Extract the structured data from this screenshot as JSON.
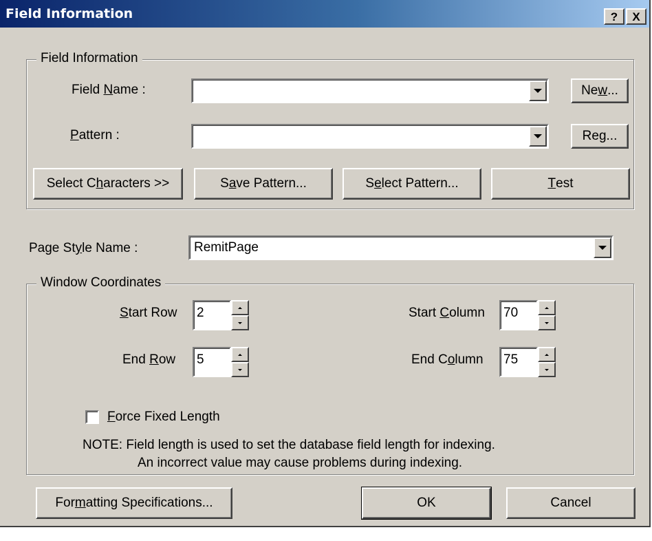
{
  "window": {
    "title": "Field Information",
    "help_button": "?",
    "close_button": "X"
  },
  "field_info_group": {
    "label": "Field Information",
    "field_name": {
      "label_pre": "Field ",
      "label_u": "N",
      "label_post": "ame  :",
      "value": ""
    },
    "pattern": {
      "label_pre": "",
      "label_u": "P",
      "label_post": "attern  :",
      "value": ""
    },
    "new_button": {
      "pre": "Ne",
      "u": "w",
      "post": "..."
    },
    "reg_button": {
      "pre": "Re",
      "u": "g",
      "post": "..."
    },
    "select_characters_button": {
      "pre": "Select C",
      "u": "h",
      "post": "aracters >>"
    },
    "save_pattern_button": {
      "pre": "S",
      "u": "a",
      "post": "ve Pattern..."
    },
    "select_pattern_button": {
      "pre": "S",
      "u": "e",
      "post": "lect Pattern..."
    },
    "test_button": {
      "pre": "",
      "u": "T",
      "post": "est"
    }
  },
  "page_style": {
    "label_pre": "Page St",
    "label_u": "y",
    "label_post": "le Name :",
    "value": "RemitPage"
  },
  "window_coords_group": {
    "label": "Window Coordinates",
    "start_row": {
      "label_pre": "",
      "label_u": "S",
      "label_post": "tart Row",
      "value": "2"
    },
    "end_row": {
      "label_pre": "End ",
      "label_u": "R",
      "label_post": "ow",
      "value": "5"
    },
    "start_column": {
      "label_pre": "Start ",
      "label_u": "C",
      "label_post": "olumn",
      "value": "70"
    },
    "end_column": {
      "label_pre": "End C",
      "label_u": "o",
      "label_post": "lumn",
      "value": "75"
    },
    "force_fixed_length": {
      "label_pre": "",
      "label_u": "F",
      "label_post": "orce Fixed Length",
      "checked": false
    },
    "note_line1": "NOTE:  Field length is used to set the database field length for indexing.",
    "note_line2": "An incorrect value may cause problems during indexing."
  },
  "footer": {
    "formatting_button": {
      "pre": "For",
      "u": "m",
      "post": "atting Specifications..."
    },
    "ok_button": "OK",
    "cancel_button": "Cancel"
  }
}
